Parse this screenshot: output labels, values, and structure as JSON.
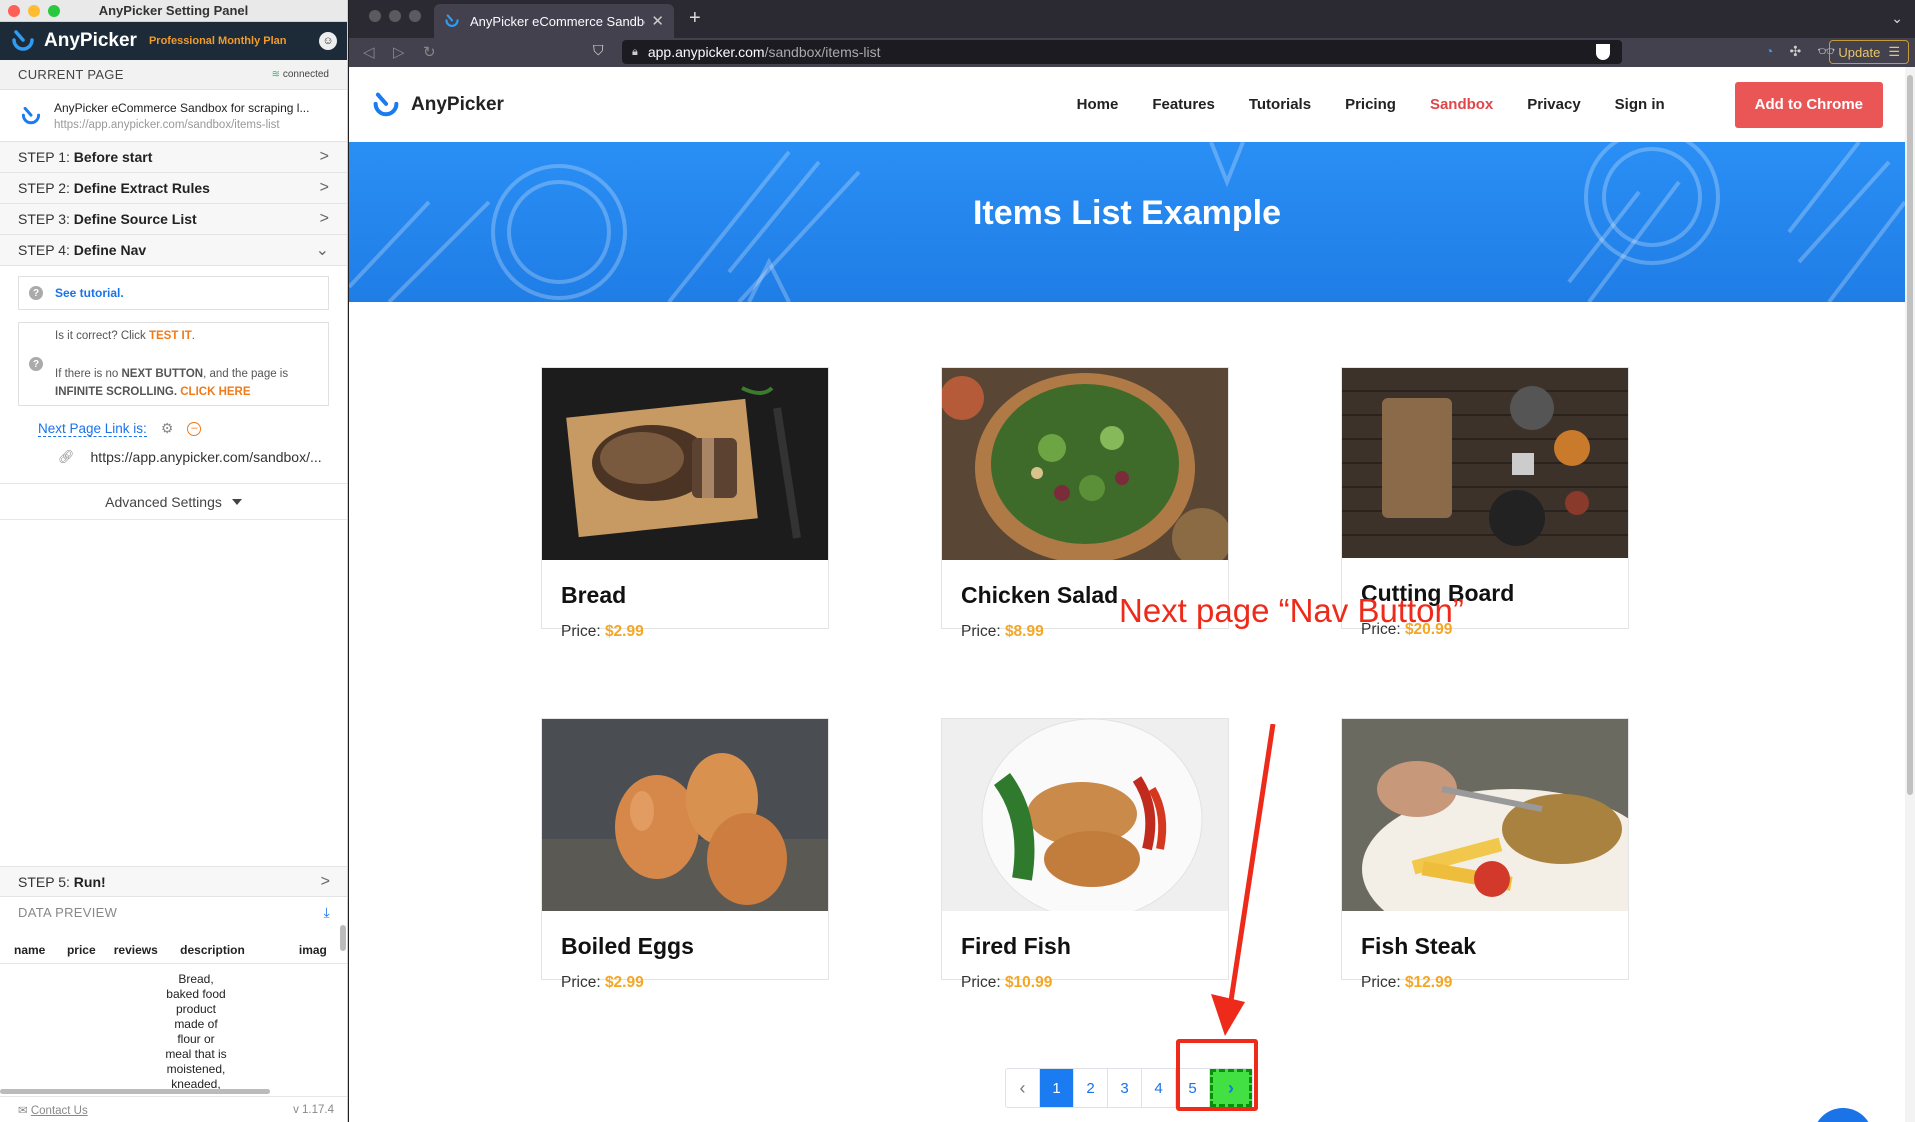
{
  "panel": {
    "window_title": "AnyPicker Setting Panel",
    "brand": "AnyPicker",
    "plan": "Professional Monthly Plan",
    "current_page_label": "CURRENT PAGE",
    "status": "connected",
    "page_title": "AnyPicker eCommerce Sandbox for scraping l...",
    "page_url": "https://app.anypicker.com/sandbox/items-list",
    "steps": [
      {
        "prefix": "STEP 1:",
        "name": "Before start",
        "chevron": ">"
      },
      {
        "prefix": "STEP 2:",
        "name": "Define Extract Rules",
        "chevron": ">"
      },
      {
        "prefix": "STEP 3:",
        "name": "Define Source List",
        "chevron": ">"
      },
      {
        "prefix": "STEP 4:",
        "name": "Define Nav",
        "chevron": "⌄"
      }
    ],
    "tutorial_link": "See tutorial",
    "test_prompt": "Is it correct? Click",
    "test_it": "TEST IT",
    "no_next_1": "If there is no",
    "next_button": "NEXT BUTTON",
    "no_next_2": ", and the page is",
    "infinite": "INFINITE SCROLLING.",
    "click_here": "CLICK HERE",
    "next_page_label": "Next Page Link is:",
    "next_page_url": "https://app.anypicker.com/sandbox/...",
    "advanced": "Advanced Settings",
    "step5_prefix": "STEP 5:",
    "step5_name": "Run!",
    "data_preview": "DATA PREVIEW",
    "columns": [
      "name",
      "price",
      "reviews",
      "description",
      "imag"
    ],
    "desc_preview": [
      "Bread,",
      "baked food",
      "product",
      "made of",
      "flour or",
      "meal that is",
      "moistened,",
      "kneaded,"
    ],
    "contact": "Contact Us",
    "version": "v 1.17.4"
  },
  "browser": {
    "tab_title": "AnyPicker eCommerce Sandbox",
    "address_host": "app.anypicker.com",
    "address_path": "/sandbox/items-list",
    "update_label": "Update"
  },
  "site": {
    "logo_text": "AnyPicker",
    "nav": [
      "Home",
      "Features",
      "Tutorials",
      "Pricing",
      "Sandbox",
      "Privacy",
      "Sign in"
    ],
    "active_nav": "Sandbox",
    "cta": "Add to Chrome",
    "hero_title": "Items List Example",
    "price_label": "Price:",
    "products": [
      {
        "name": "Bread",
        "price": "$2.99"
      },
      {
        "name": "Chicken Salad",
        "price": "$8.99"
      },
      {
        "name": "Cutting Board",
        "price": "$20.99"
      },
      {
        "name": "Boiled Eggs",
        "price": "$2.99"
      },
      {
        "name": "Fired Fish",
        "price": "$10.99"
      },
      {
        "name": "Fish Steak",
        "price": "$12.99"
      }
    ],
    "pages": [
      "1",
      "2",
      "3",
      "4",
      "5"
    ],
    "current_page": "1",
    "annotation": "Next page “Nav Button”"
  },
  "colors": {
    "brand_dark": "#1d2b38",
    "accent_blue": "#1a7cf0",
    "cta_red": "#ea5656",
    "price_orange": "#f5a623",
    "annotation_red": "#ee2b1a",
    "highlight_green": "#43e043"
  }
}
